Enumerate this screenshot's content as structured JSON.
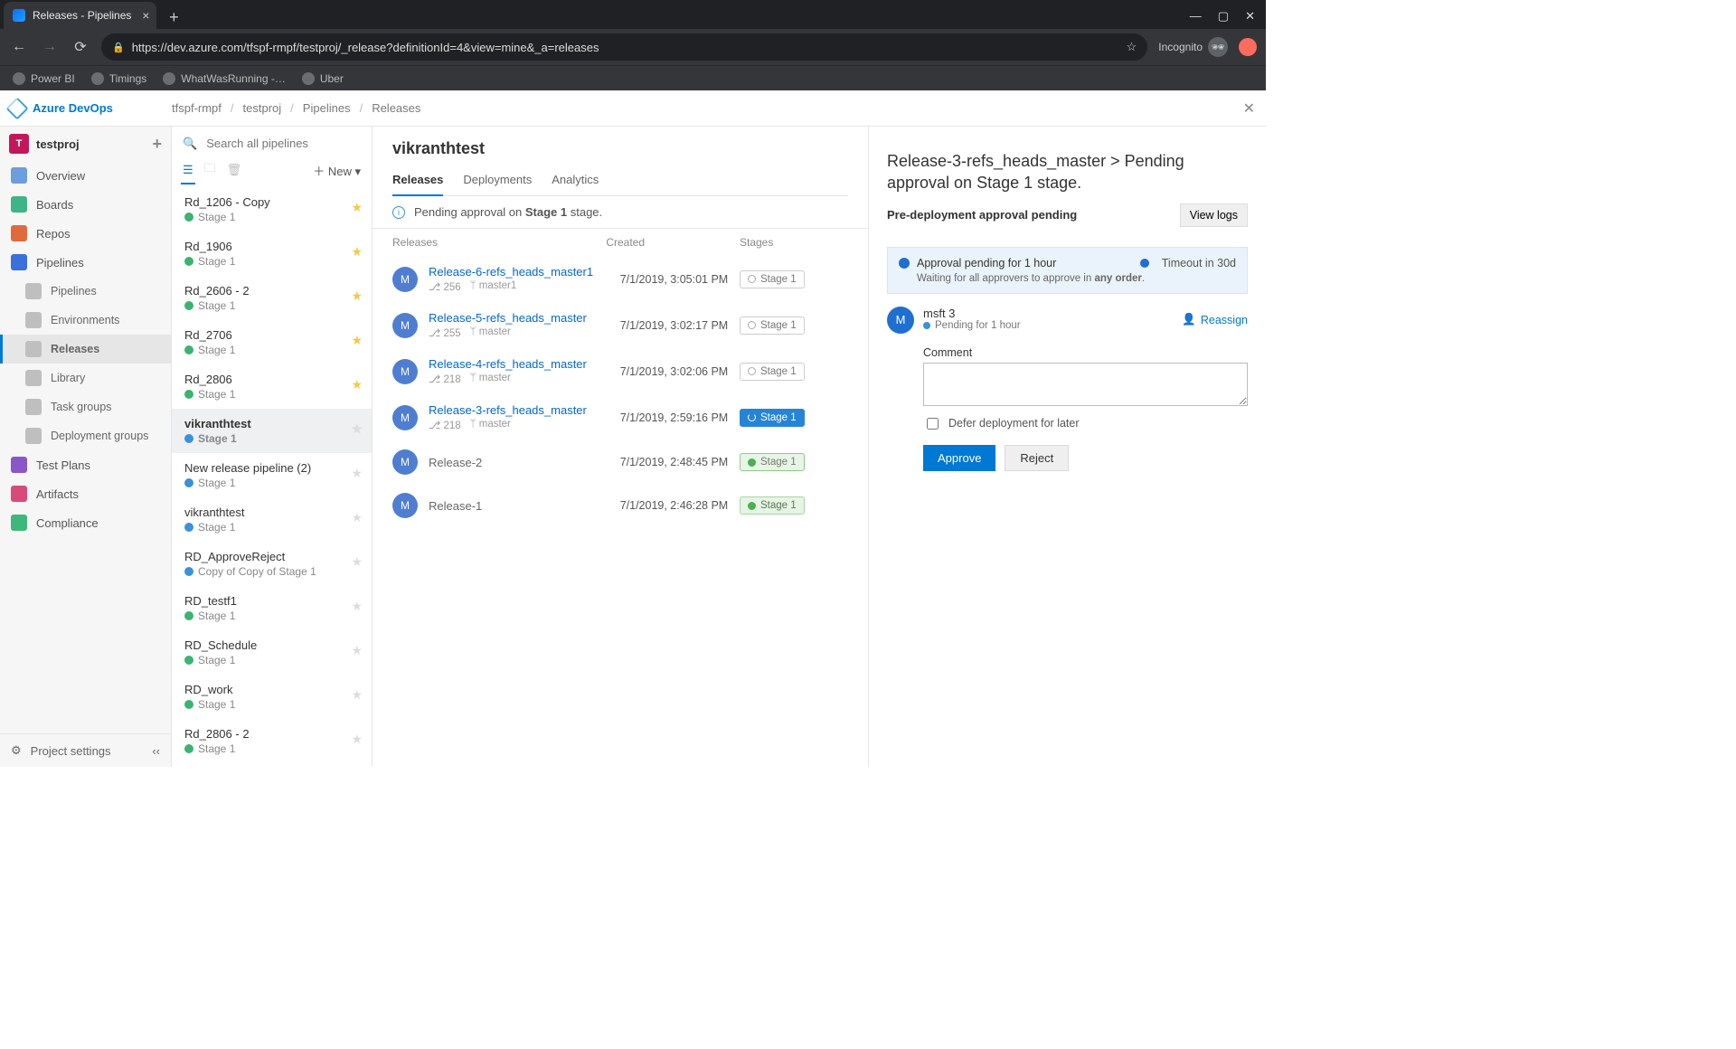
{
  "browser": {
    "tab_title": "Releases - Pipelines",
    "url": "https://dev.azure.com/tfspf-rmpf/testproj/_release?definitionId=4&view=mine&_a=releases",
    "incognito_label": "Incognito",
    "bookmarks": [
      "Power BI",
      "Timings",
      "WhatWasRunning -…",
      "Uber"
    ]
  },
  "topbar": {
    "product": "Azure DevOps",
    "crumbs": [
      "tfspf-rmpf",
      "testproj",
      "Pipelines",
      "Releases"
    ]
  },
  "project": {
    "name": "testproj",
    "initial": "T"
  },
  "nav": {
    "items": [
      {
        "label": "Overview",
        "icon": "#6a9edc"
      },
      {
        "label": "Boards",
        "icon": "#3eb489"
      },
      {
        "label": "Repos",
        "icon": "#e06a3b"
      },
      {
        "label": "Pipelines",
        "icon": "#3b6fdc",
        "expanded": true,
        "children": [
          {
            "label": "Pipelines"
          },
          {
            "label": "Environments"
          },
          {
            "label": "Releases",
            "active": true
          },
          {
            "label": "Library"
          },
          {
            "label": "Task groups"
          },
          {
            "label": "Deployment groups"
          }
        ]
      },
      {
        "label": "Test Plans",
        "icon": "#8a57c8"
      },
      {
        "label": "Artifacts",
        "icon": "#d84a7a"
      },
      {
        "label": "Compliance",
        "icon": "#3fb77a"
      }
    ],
    "footer": "Project settings"
  },
  "search": {
    "placeholder": "Search all pipelines"
  },
  "listtools": {
    "new_label": "New"
  },
  "pipelines": [
    {
      "name": "Rd_1206 - Copy",
      "status": "green",
      "stage": "Stage 1",
      "star": true
    },
    {
      "name": "Rd_1906",
      "status": "green",
      "stage": "Stage 1",
      "star": true
    },
    {
      "name": "Rd_2606 - 2",
      "status": "green",
      "stage": "Stage 1",
      "star": true
    },
    {
      "name": "Rd_2706",
      "status": "green",
      "stage": "Stage 1",
      "star": true
    },
    {
      "name": "Rd_2806",
      "status": "green",
      "stage": "Stage 1",
      "star": true
    },
    {
      "name": "vikranthtest",
      "status": "blue",
      "stage": "Stage 1",
      "star": false,
      "selected": true
    },
    {
      "name": "New release pipeline (2)",
      "status": "blue",
      "stage": "Stage 1",
      "star": false
    },
    {
      "name": "vikranthtest",
      "status": "blue",
      "stage": "Stage 1",
      "star": false
    },
    {
      "name": "RD_ApproveReject",
      "status": "blue",
      "stage": "Copy of Copy of Stage 1",
      "star": false
    },
    {
      "name": "RD_testf1",
      "status": "green",
      "stage": "Stage 1",
      "star": false
    },
    {
      "name": "RD_Schedule",
      "status": "green",
      "stage": "Stage 1",
      "star": false
    },
    {
      "name": "RD_work",
      "status": "green",
      "stage": "Stage 1",
      "star": false
    },
    {
      "name": "Rd_2806 - 2",
      "status": "green",
      "stage": "Stage 1",
      "star": false
    }
  ],
  "main": {
    "heading": "vikranthtest",
    "tabs": [
      {
        "label": "Releases",
        "active": true
      },
      {
        "label": "Deployments"
      },
      {
        "label": "Analytics"
      }
    ],
    "banner_prefix": "Pending approval on ",
    "banner_bold": "Stage 1",
    "banner_suffix": " stage.",
    "columns": {
      "releases": "Releases",
      "created": "Created",
      "stages": "Stages"
    },
    "rows": [
      {
        "title": "Release-6-refs_heads_master1",
        "build": "256",
        "branch": "master1",
        "created": "7/1/2019, 3:05:01 PM",
        "stage": "Stage 1",
        "state": "pending"
      },
      {
        "title": "Release-5-refs_heads_master",
        "build": "255",
        "branch": "master",
        "created": "7/1/2019, 3:02:17 PM",
        "stage": "Stage 1",
        "state": "pending"
      },
      {
        "title": "Release-4-refs_heads_master",
        "build": "218",
        "branch": "master",
        "created": "7/1/2019, 3:02:06 PM",
        "stage": "Stage 1",
        "state": "pending"
      },
      {
        "title": "Release-3-refs_heads_master",
        "build": "218",
        "branch": "master",
        "created": "7/1/2019, 2:59:16 PM",
        "stage": "Stage 1",
        "state": "running"
      },
      {
        "title": "Release-2",
        "created": "7/1/2019, 2:48:45 PM",
        "stage": "Stage 1",
        "state": "success-box"
      },
      {
        "title": "Release-1",
        "created": "7/1/2019, 2:46:28 PM",
        "stage": "Stage 1",
        "state": "success"
      }
    ],
    "avatar_letter": "M"
  },
  "panel": {
    "title": "Release-3-refs_heads_master  >  Pending approval on Stage 1 stage.",
    "sub": "Pre-deployment approval pending",
    "view_logs": "View logs",
    "alert_title": "Approval pending for 1 hour",
    "alert_sub_prefix": "Waiting for all approvers to approve in ",
    "alert_sub_bold": "any order",
    "timeout": "Timeout in 30d",
    "approver": {
      "name": "msft 3",
      "pending": "Pending for 1 hour",
      "letter": "M"
    },
    "reassign": "Reassign",
    "comment_label": "Comment",
    "defer": "Defer deployment for later",
    "approve": "Approve",
    "reject": "Reject"
  }
}
